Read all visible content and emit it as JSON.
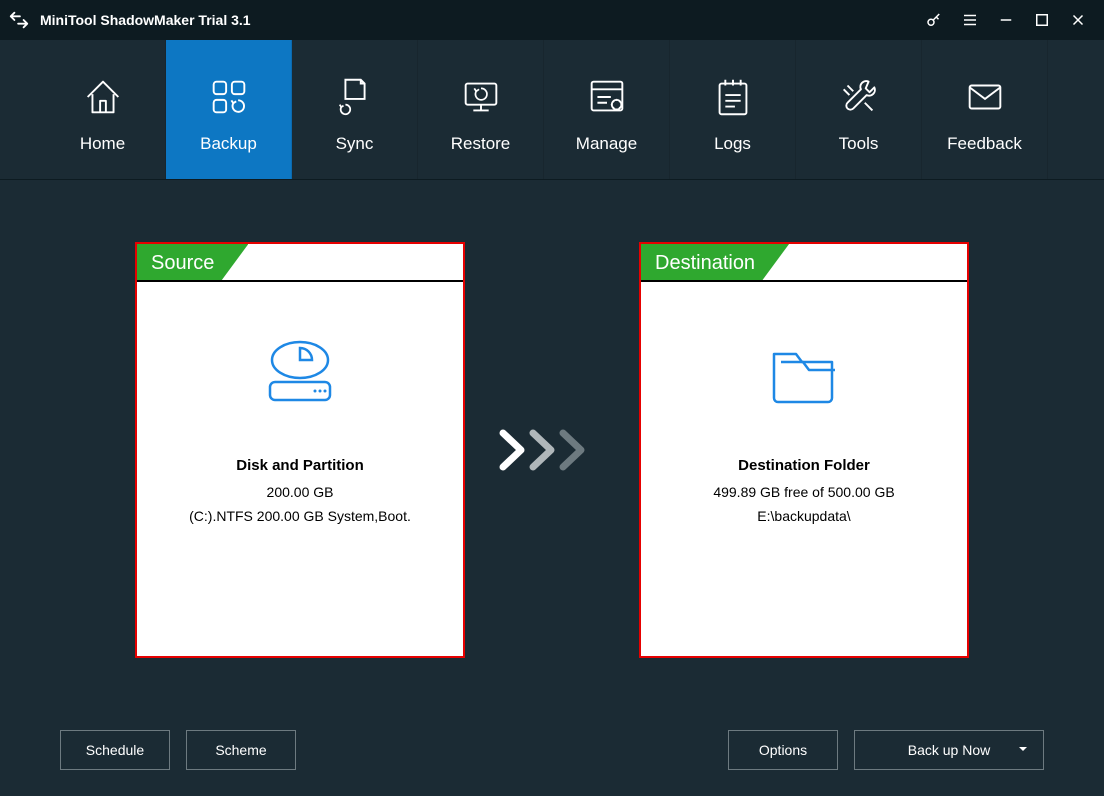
{
  "app": {
    "title": "MiniTool ShadowMaker Trial 3.1"
  },
  "nav": {
    "items": [
      {
        "label": "Home"
      },
      {
        "label": "Backup"
      },
      {
        "label": "Sync"
      },
      {
        "label": "Restore"
      },
      {
        "label": "Manage"
      },
      {
        "label": "Logs"
      },
      {
        "label": "Tools"
      },
      {
        "label": "Feedback"
      }
    ]
  },
  "source": {
    "tab": "Source",
    "title": "Disk and Partition",
    "size": "200.00 GB",
    "detail": "(C:).NTFS 200.00 GB System,Boot."
  },
  "destination": {
    "tab": "Destination",
    "title": "Destination Folder",
    "free": "499.89 GB free of 500.00 GB",
    "path": "E:\\backupdata\\"
  },
  "footer": {
    "schedule": "Schedule",
    "scheme": "Scheme",
    "options": "Options",
    "backup_now": "Back up Now"
  }
}
